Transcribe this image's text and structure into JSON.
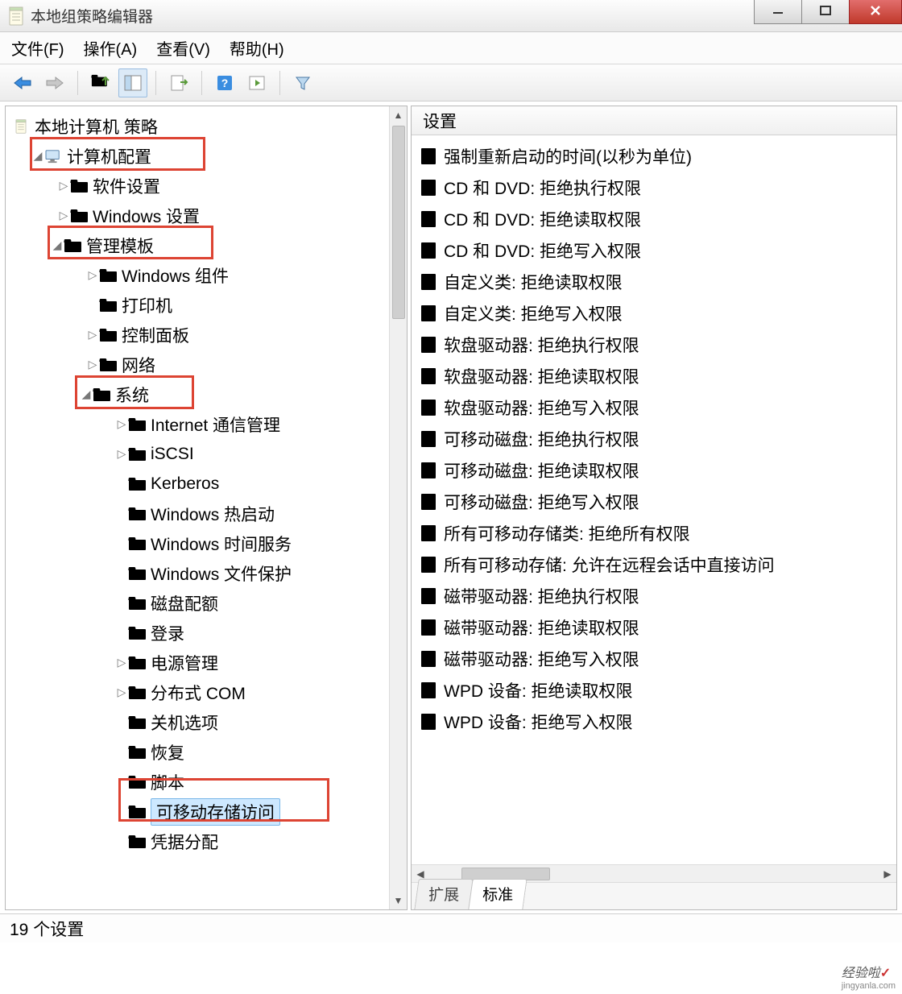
{
  "window": {
    "title": "本地组策略编辑器"
  },
  "menu": {
    "file": "文件(F)",
    "action": "操作(A)",
    "view": "查看(V)",
    "help": "帮助(H)"
  },
  "tree": {
    "root": "本地计算机 策略",
    "computer_config": "计算机配置",
    "software_settings": "软件设置",
    "windows_settings": "Windows 设置",
    "admin_templates": "管理模板",
    "win_components": "Windows 组件",
    "printers": "打印机",
    "control_panel": "控制面板",
    "network": "网络",
    "system": "系统",
    "internet_comm": "Internet 通信管理",
    "iscsi": "iSCSI",
    "kerberos": "Kerberos",
    "win_hotstart": "Windows 热启动",
    "win_time": "Windows 时间服务",
    "win_fileprotect": "Windows 文件保护",
    "disk_quota": "磁盘配额",
    "logon": "登录",
    "power_mgmt": "电源管理",
    "dcom": "分布式 COM",
    "shutdown_opts": "关机选项",
    "recovery": "恢复",
    "scripts": "脚本",
    "removable_storage": "可移动存储访问",
    "cred_deleg": "凭据分配"
  },
  "list": {
    "header": "设置",
    "items": [
      "强制重新启动的时间(以秒为单位)",
      "CD 和 DVD: 拒绝执行权限",
      "CD 和 DVD: 拒绝读取权限",
      "CD 和 DVD: 拒绝写入权限",
      "自定义类: 拒绝读取权限",
      "自定义类: 拒绝写入权限",
      "软盘驱动器: 拒绝执行权限",
      "软盘驱动器: 拒绝读取权限",
      "软盘驱动器: 拒绝写入权限",
      "可移动磁盘: 拒绝执行权限",
      "可移动磁盘: 拒绝读取权限",
      "可移动磁盘: 拒绝写入权限",
      "所有可移动存储类: 拒绝所有权限",
      "所有可移动存储: 允许在远程会话中直接访问",
      "磁带驱动器: 拒绝执行权限",
      "磁带驱动器: 拒绝读取权限",
      "磁带驱动器: 拒绝写入权限",
      "WPD 设备: 拒绝读取权限",
      "WPD 设备: 拒绝写入权限"
    ]
  },
  "tabs": {
    "extended": "扩展",
    "standard": "标准"
  },
  "status": {
    "text": "19 个设置"
  },
  "watermark": {
    "brand": "经验啦",
    "url": "jingyanla.com"
  }
}
